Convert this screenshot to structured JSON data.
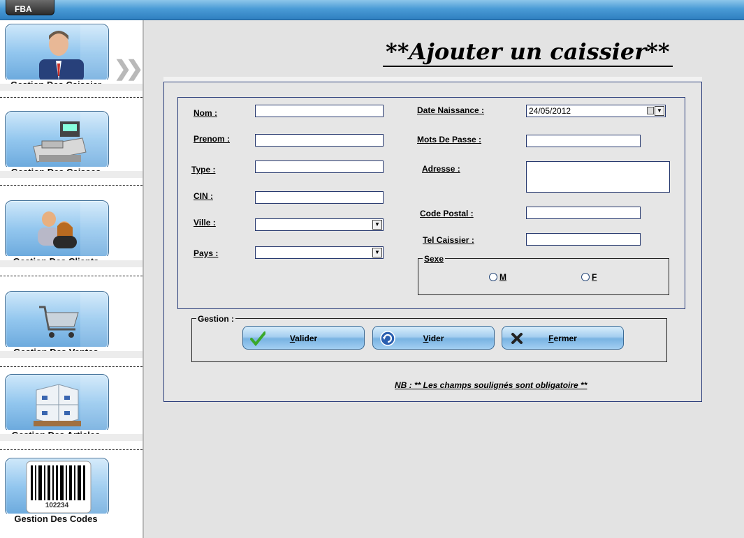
{
  "window": {
    "tab_label": "FBA"
  },
  "sidebar": {
    "items": [
      {
        "label": "Gestion Des Caissier",
        "icon": "businessman-icon"
      },
      {
        "label": "Gestion Des Caisses",
        "icon": "cash-register-icon"
      },
      {
        "label": "Gestion Des Clients",
        "icon": "clients-icon"
      },
      {
        "label": "Gestion Des Ventes",
        "icon": "shopping-cart-icon"
      },
      {
        "label": "Gestion Des Articles",
        "icon": "boxes-icon"
      },
      {
        "label": "Gestion Des Codes",
        "icon": "barcode-icon"
      }
    ],
    "barcode_number": "102234"
  },
  "page": {
    "title": "**Ajouter un caissier**"
  },
  "form": {
    "nom_label": "Nom  :",
    "prenom_label": "Prenom :",
    "type_label": "Type :",
    "cin_label": "CIN :",
    "ville_label": "Ville :",
    "pays_label": "Pays :",
    "date_label": "Date Naissance :",
    "date_value": "24/05/2012",
    "mdp_label": "Mots De Passe :",
    "adresse_label": "Adresse :",
    "cp_label": "Code Postal :",
    "tel_label": "Tel Caissier :",
    "nom_value": "",
    "prenom_value": "",
    "type_value": "",
    "cin_value": "",
    "ville_value": "",
    "pays_value": "",
    "mdp_value": "",
    "adresse_value": "",
    "cp_value": "",
    "tel_value": ""
  },
  "sexe": {
    "title": "Sexe",
    "option_m": "M",
    "option_f": "F"
  },
  "gestion": {
    "title": "Gestion :",
    "valider": "Valider",
    "vider": "Vider",
    "fermer": "Fermer"
  },
  "note": "NB : ** Les champs soulignés sont obligatoire **",
  "colors": {
    "title_bar": "#2f7fc0",
    "frame_border": "#2a3d7a",
    "button_blue": "#a5cff0"
  }
}
